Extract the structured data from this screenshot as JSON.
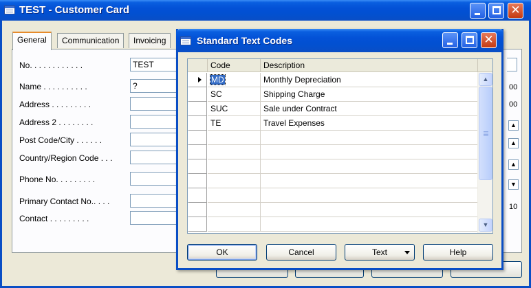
{
  "main": {
    "title": "TEST - Customer Card",
    "tabs": [
      {
        "label": "General"
      },
      {
        "label": "Communication"
      },
      {
        "label": "Invoicing"
      }
    ],
    "fields": [
      {
        "label": "No. . . . . . . . . . . .",
        "value": "TEST"
      },
      {
        "label": "Name . . . . . . . . . .",
        "value": "?"
      },
      {
        "label": "Address . . . . . . . . .",
        "value": ""
      },
      {
        "label": "Address 2 . . . . . . . .",
        "value": ""
      },
      {
        "label": "Post Code/City . . . . . .",
        "value": ""
      },
      {
        "label": "Country/Region Code . . .",
        "value": ""
      },
      {
        "label": "Phone No. . . . . . . . .",
        "value": ""
      },
      {
        "label": "Primary Contact No.. . . .",
        "value": ""
      },
      {
        "label": "Contact . . . . . . . . .",
        "value": ""
      }
    ],
    "right_stubs": [
      "00",
      "00",
      "10"
    ]
  },
  "dialog": {
    "title": "Standard Text Codes",
    "columns": {
      "code": "Code",
      "description": "Description"
    },
    "rows": [
      {
        "code": "MD",
        "description": "Monthly Depreciation"
      },
      {
        "code": "SC",
        "description": "Shipping Charge"
      },
      {
        "code": "SUC",
        "description": "Sale under Contract"
      },
      {
        "code": "TE",
        "description": "Travel Expenses"
      },
      {
        "code": "",
        "description": ""
      },
      {
        "code": "",
        "description": ""
      },
      {
        "code": "",
        "description": ""
      },
      {
        "code": "",
        "description": ""
      },
      {
        "code": "",
        "description": ""
      },
      {
        "code": "",
        "description": ""
      },
      {
        "code": "",
        "description": ""
      }
    ],
    "buttons": {
      "ok": "OK",
      "cancel": "Cancel",
      "text": "Text",
      "help": "Help"
    }
  },
  "colors": {
    "titlebar": "#0351d6",
    "selection": "#316ac5",
    "window_bg": "#ece9d8"
  }
}
